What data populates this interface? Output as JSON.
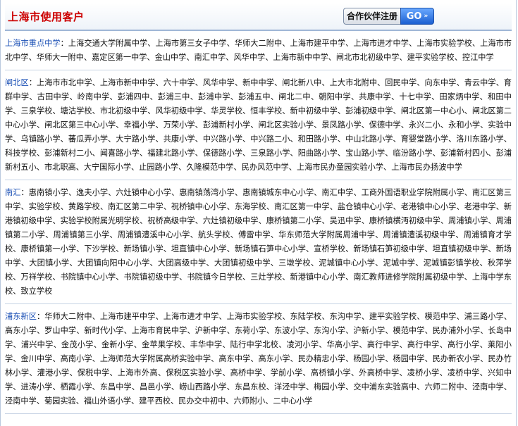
{
  "header": {
    "title": "上海市使用客户",
    "partner_label": "合作伙伴注册",
    "go_label": "GO"
  },
  "sections": [
    {
      "name": "上海市重点中学",
      "colon": "：",
      "text": "上海交通大学附属中学、上海市第三女子中学、华师大二附中、上海市建平中学、上海市进才中学、上海市实验学校、上海市市北中学、华师大一附中、嘉定区第一中学、金山中学、南汇中学、风华中学、上海市新中中学、闸北市北初级中学、建平实验学校、控江中学"
    },
    {
      "name": "闸北区",
      "colon": "：",
      "text": "上海市市北中学、上海市新中中学、六十中学、风华中学、新中中学、闸北新八中、上大市北附中、回民中学、向东中学、青云中学、育群中学、古田中学、岭南中学、彭浦四中、彭浦三中、彭浦中学、彭浦五中、闸北二中、朝阳中学、共康中学、十七中学、田家炳中学、和田中学、三泉学校、塘沽学校、市北初级中学、风华初级中学、华灵学校、恒丰学校、新中初级中学、彭浦初级中学、闸北区第一中心小、闸北区第二中心小学、闸北区第三中心小学、幸福小学、万荣小学、彭浦新村小学、闸北区实验小学、景凤路小学、保德中学、永兴二小、永和小学、实验中学、乌镇路小学、蕃瓜弄小学、大宁路小学、共康小学、中兴路小学、中兴路二小、和田路小学、中山北路小学、育婴堂路小学、洛川东路小学、科技学校、彭浦新村二小、闻喜路小学、福建北路小学、保德路小学、三泉路小学、阳曲路小学、宝山路小学、临汾路小学、彭浦新村四小、彭浦新村五小、市北职高、大宁国际小学、止园路小学、久隆模范中学、民办风范中学、上海市民办童园实验小学、上海市民办扬波中学"
    },
    {
      "name": "南汇",
      "colon": "：",
      "text": "惠南镇小学、逸夫小学、六灶镇中心小学、惠南镇荡湾小学、惠南镇城东中心小学、南汇中学、工商外国语职业学院附属小学、南汇区第三中学、实验学校、黄路学校、南汇区第二中学、祝桥镇中心小学、东海学校、南汇区第一中学、盐仓镇中心小学、老港镇中心小学、老港中学、新港镇初级中学、实验学校附属光明学校、祝桥高级中学、六灶镇初级中学、康桥镇第二小学、吴迅中学、康桥镇横沔初级中学、周浦镇小学、周浦镇第二小学、周浦镇第三小学、周浦镇澧溪中心小学、航头学校、傅雷中学、华东师范大学附属周浦中学、周浦镇澧溪初级中学、周浦镇育才学校、康桥镇第一小学、下沙学校、新场镇小学、坦直镇中心小学、新场镇石笋中心小学、宣桥学校、新场镇石笋初级中学、坦直镇初级中学、新场中学、大团镇小学、大团镇向阳中心小学、大团高级中学、大团镇初级中学、三墩学校、泥城镇中心小学、泥城中学、泥城镇彭镇学校、秋萍学校、万祥学校、书院镇中心小学、书院镇初级中学、书院镇今日学校、三灶学校、新港镇中心小学、南汇教师进修学院附属初级中学、上海中学东校、致立学校"
    },
    {
      "name": "浦东新区",
      "colon": "：",
      "text": "华师大二附中、上海市建平中学、上海市进才中学、上海市实验学校、东陆学校、东沟中学、建平实验学校、模范中学、浦三路小学、高东小学、罗山中学、新时代小学、上海市育民中学、沪新中学、东荷小学、东波小学、东沟小学、沪新小学、模范中学、民办浦外小学、长岛中学、浦兴中学、金茂小学、金新小学、金苹果学校、丰华中学、陆行中学北校、凌河小学、华高小学、高行中学、高行中学、高行小学、莱阳小学、金川中学、高南小学、上海师范大学附属高桥实验中学、高东中学、高东小学、民办精忠小学、杨园小学、杨园中学、民办新农小学、民办竹林小学、灌港小学、保税中学、上海市外高、保税区实验小学、高桥中学、学前小学、高桥镇小学、外高桥中学、凌桥小学、凌桥中学、兴知中学、进涛小学、栖霞小学、东昌中学、昌邑小学、崂山西路小学、东昌东校、洋泾中学、梅园小学、交中浦东实验高中、六师二附中、泾南中学、泾南中学、菊园实验、福山外语小学、建平西校、民办交中初中、六师附小、二中心小学"
    }
  ]
}
